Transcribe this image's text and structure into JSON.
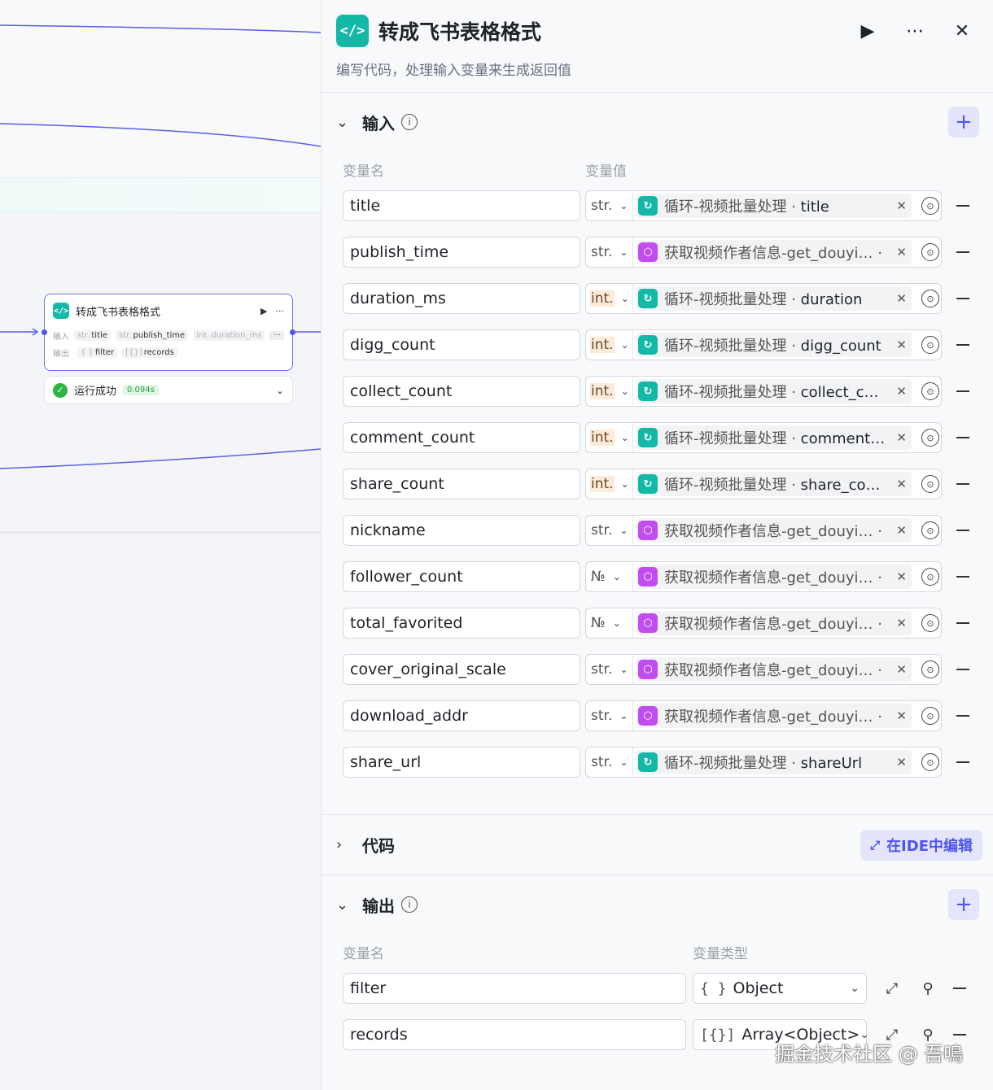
{
  "canvas": {
    "node": {
      "icon": "code-icon",
      "title": "转成飞书表格格式",
      "run_icon": "▶",
      "more_icon": "···",
      "input_label": "输入",
      "output_label": "输出",
      "inputs": [
        {
          "type": "str.",
          "name": "title"
        },
        {
          "type": "str.",
          "name": "publish_time"
        },
        {
          "type": "int.",
          "name": "duration_ms"
        }
      ],
      "more": "···",
      "outputs": [
        {
          "type": "{ }",
          "name": "filter"
        },
        {
          "type": "[{}]",
          "name": "records"
        }
      ]
    },
    "status": {
      "text": "运行成功",
      "time": "0.094s"
    }
  },
  "panel": {
    "title": "转成飞书表格格式",
    "description": "编写代码，处理输入变量来生成返回值",
    "input_section": {
      "title": "输入",
      "col_name": "变量名",
      "col_value": "变量值",
      "rows": [
        {
          "name": "title",
          "type": "str.",
          "source_kind": "loop",
          "source": "循环-视频批量处理",
          "field": "title"
        },
        {
          "name": "publish_time",
          "type": "str.",
          "source_kind": "plugin",
          "source": "获取视频作者信息-get_douyi…",
          "field": ""
        },
        {
          "name": "duration_ms",
          "type": "int.",
          "source_kind": "loop",
          "source": "循环-视频批量处理",
          "field": "duration"
        },
        {
          "name": "digg_count",
          "type": "int.",
          "source_kind": "loop",
          "source": "循环-视频批量处理",
          "field": "digg_count"
        },
        {
          "name": "collect_count",
          "type": "int.",
          "source_kind": "loop",
          "source": "循环-视频批量处理",
          "field": "collect_c…"
        },
        {
          "name": "comment_count",
          "type": "int.",
          "source_kind": "loop",
          "source": "循环-视频批量处理",
          "field": "comment…"
        },
        {
          "name": "share_count",
          "type": "int.",
          "source_kind": "loop",
          "source": "循环-视频批量处理",
          "field": "share_co…"
        },
        {
          "name": "nickname",
          "type": "str.",
          "source_kind": "plugin",
          "source": "获取视频作者信息-get_douyi…",
          "field": ""
        },
        {
          "name": "follower_count",
          "type": "№",
          "source_kind": "plugin",
          "source": "获取视频作者信息-get_douyi…",
          "field": ""
        },
        {
          "name": "total_favorited",
          "type": "№",
          "source_kind": "plugin",
          "source": "获取视频作者信息-get_douyi…",
          "field": ""
        },
        {
          "name": "cover_original_scale",
          "type": "str.",
          "source_kind": "plugin",
          "source": "获取视频作者信息-get_douyi…",
          "field": ""
        },
        {
          "name": "download_addr",
          "type": "str.",
          "source_kind": "plugin",
          "source": "获取视频作者信息-get_douyi…",
          "field": ""
        },
        {
          "name": "share_url",
          "type": "str.",
          "source_kind": "loop",
          "source": "循环-视频批量处理",
          "field": "shareUrl"
        }
      ]
    },
    "code_section": {
      "title": "代码",
      "ide_button": "在IDE中编辑"
    },
    "output_section": {
      "title": "输出",
      "col_name": "变量名",
      "col_type": "变量类型",
      "rows": [
        {
          "name": "filter",
          "type_glyph": "{ }",
          "type": "Object"
        },
        {
          "name": "records",
          "type_glyph": "[{}]",
          "type": "Array<Object>"
        }
      ]
    }
  },
  "watermark": "掘金技术社区 @ 吾鳴",
  "colors": {
    "accent": "#4e56f0",
    "code_icon": "#14b8a6",
    "plugin_icon": "#c14cf0",
    "success": "#2fb344"
  }
}
